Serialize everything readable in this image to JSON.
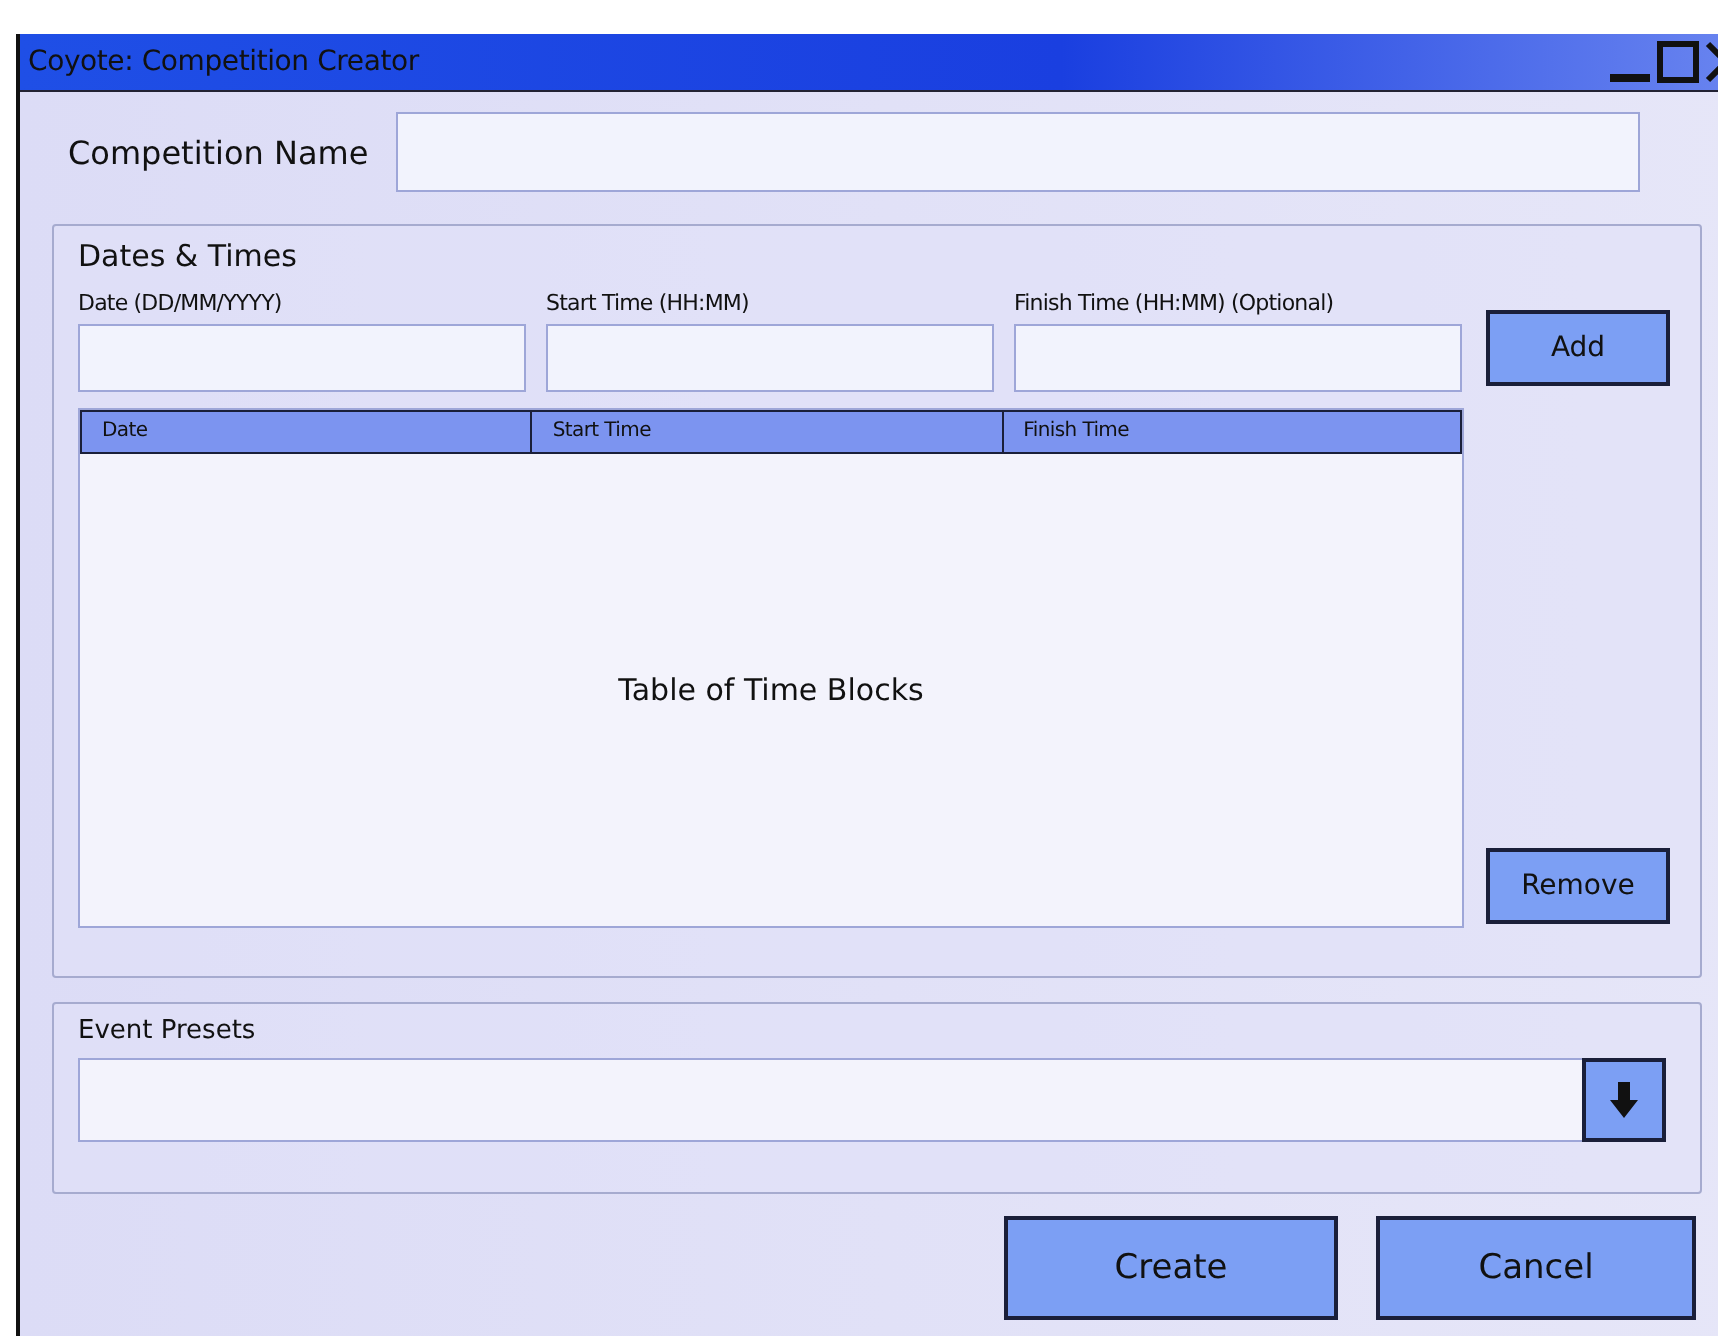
{
  "window": {
    "title": "Coyote:  Competition Creator"
  },
  "competition_name": {
    "label": "Competition Name"
  },
  "dates_times": {
    "title": "Dates & Times",
    "fields": [
      {
        "label": "Date (DD/MM/YYYY)"
      },
      {
        "label": "Start Time (HH:MM)"
      },
      {
        "label": "Finish Time (HH:MM) (Optional)"
      }
    ],
    "add_button": "Add",
    "table": {
      "columns": [
        "Date",
        "Start Time",
        "Finish Time"
      ],
      "placeholder_text": "Table of Time Blocks"
    },
    "remove_button": "Remove"
  },
  "event_presets": {
    "label": "Event Presets"
  },
  "buttons": [
    "Create",
    "Cancel"
  ]
}
